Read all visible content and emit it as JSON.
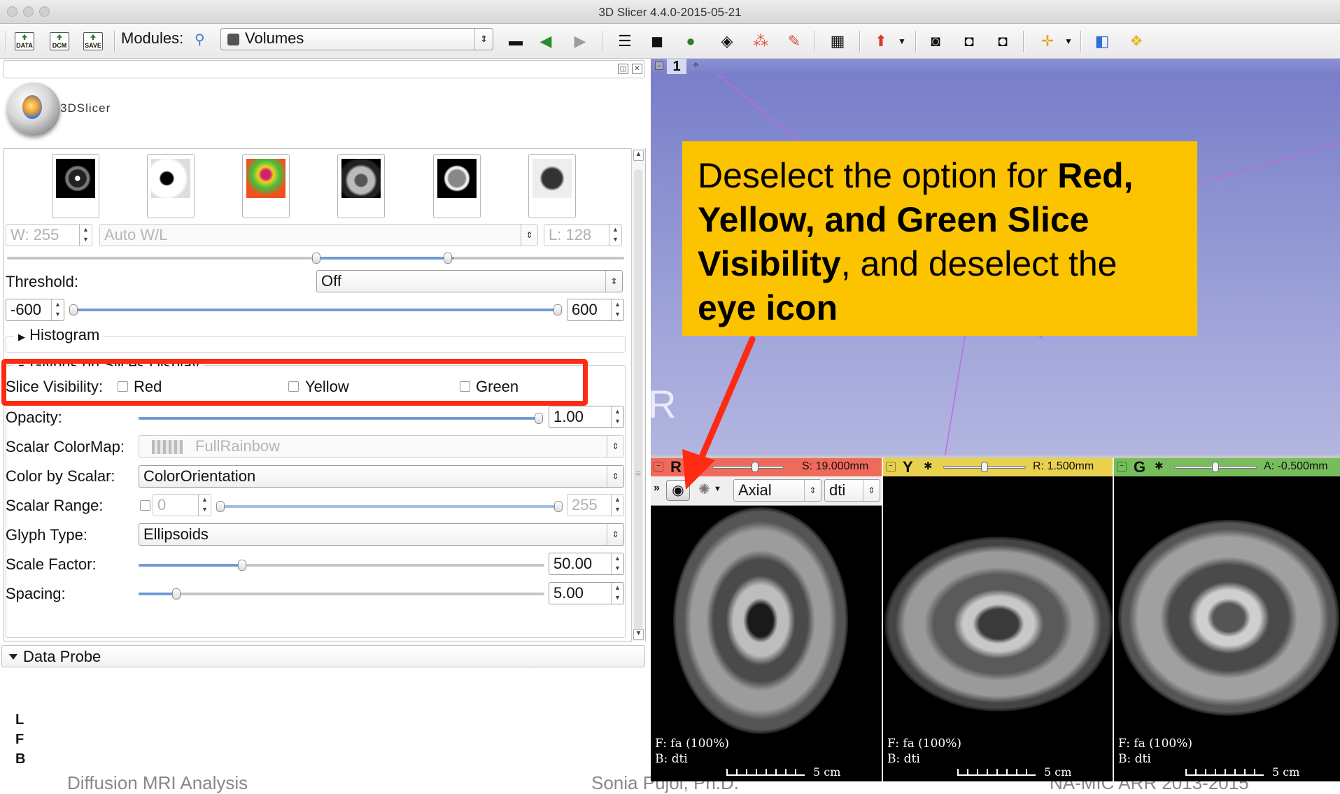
{
  "window": {
    "title": "3D Slicer 4.4.0-2015-05-21"
  },
  "toolbar": {
    "data_btn": "DATA",
    "dcm_btn": "DCM",
    "save_btn": "SAVE",
    "modules_label": "Modules:",
    "module_selected": "Volumes"
  },
  "logo_text": "3DSlicer",
  "window_level": {
    "window_value": "W: 255",
    "mode": "Auto W/L",
    "level_value": "L: 128"
  },
  "threshold": {
    "label": "Threshold:",
    "value": "Off",
    "min": "-600",
    "max": "600"
  },
  "histogram_label": "Histogram",
  "glyphs": {
    "section_title": "Glyphs on Slices Display",
    "slice_visibility_label": "Slice Visibility:",
    "red": "Red",
    "yellow": "Yellow",
    "green": "Green"
  },
  "properties": {
    "opacity_label": "Opacity:",
    "opacity_value": "1.00",
    "scalar_colormap_label": "Scalar ColorMap:",
    "scalar_colormap_value": "FullRainbow",
    "color_by_scalar_label": "Color by Scalar:",
    "color_by_scalar_value": "ColorOrientation",
    "scalar_range_label": "Scalar Range:",
    "scalar_range_min": "0",
    "scalar_range_max": "255",
    "glyph_type_label": "Glyph Type:",
    "glyph_type_value": "Ellipsoids",
    "scale_factor_label": "Scale Factor:",
    "scale_factor_value": "50.00",
    "spacing_label": "Spacing:",
    "spacing_value": "5.00"
  },
  "data_probe_label": "Data Probe",
  "lfb": [
    "L",
    "F",
    "B"
  ],
  "footer": {
    "left": "Diffusion MRI Analysis",
    "middle": "Sonia Pujol, Ph.D.",
    "right": "NA-MIC ARR 2013-2015"
  },
  "view3d": {
    "view_number": "1",
    "orientation_letter": "R",
    "annotation": {
      "part1": "Deselect the option for ",
      "bold1": "Red, Yellow, and Green  Slice Visibility",
      "part2": ", and deselect the ",
      "bold2": "eye icon"
    }
  },
  "slices": [
    {
      "letter": "R",
      "offset": "S: 19.000mm",
      "color": "#f06a5c",
      "fg": "F: fa (100%)",
      "bg": "B: dti",
      "scale": "5 cm",
      "position_fraction": 0.6
    },
    {
      "letter": "Y",
      "offset": "R: 1.500mm",
      "color": "#e8d14f",
      "fg": "F: fa (100%)",
      "bg": "B: dti",
      "scale": "5 cm",
      "position_fraction": 0.5
    },
    {
      "letter": "G",
      "offset": "A: -0.500mm",
      "color": "#77bd5c",
      "fg": "F: fa (100%)",
      "bg": "B: dti",
      "scale": "5 cm",
      "position_fraction": 0.5
    }
  ],
  "slice_controls": {
    "orientation": "Axial",
    "volume": "dti"
  },
  "colors": {
    "highlight": "#ff2a12",
    "annotation_bg": "#fcc300",
    "view3d_bg": "#8e93d3"
  }
}
